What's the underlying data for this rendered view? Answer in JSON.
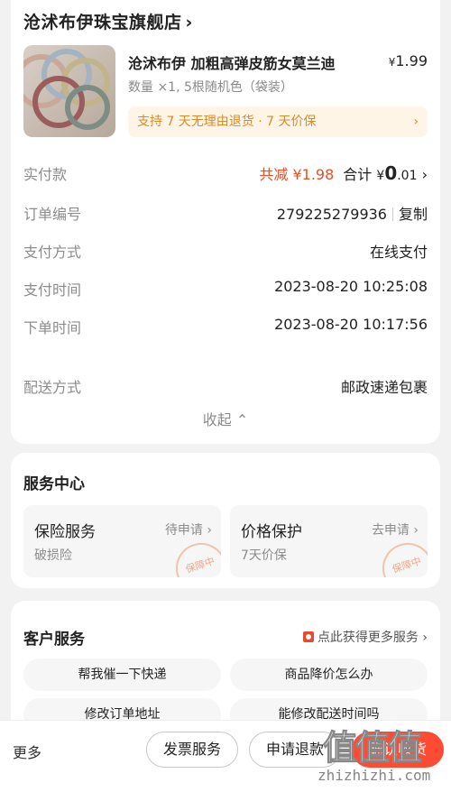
{
  "store": {
    "name": "沧沭布伊珠宝旗舰店",
    "chevron": "›"
  },
  "product": {
    "title": "沧沭布伊 加粗高弹皮筋女莫兰迪",
    "price_symbol": "¥",
    "price": "1.99",
    "spec": "数量 ×1, 5根随机色（袋装）",
    "promo": "支持 7 天无理由退货 · 7 天价保",
    "promo_chevron": "›",
    "image_icon": "hair-ties-photo"
  },
  "payment": {
    "paid_label": "实付款",
    "saved_text": "共减 ¥1.98",
    "total_label": "合计",
    "total_symbol": "¥",
    "total_int": "0",
    "total_dec": ".01",
    "chevron": "›"
  },
  "order_info": [
    {
      "label": "订单编号",
      "value": "279225279936",
      "action": "复制"
    },
    {
      "label": "支付方式",
      "value": "在线支付"
    },
    {
      "label": "支付时间",
      "value": "2023-08-20 10:25:08"
    },
    {
      "label": "下单时间",
      "value": "2023-08-20 10:17:56"
    },
    {
      "label": "配送方式",
      "value": "邮政速递包裹"
    }
  ],
  "collapse_label": "收起 ⌃",
  "service_center": {
    "title": "服务中心",
    "items": [
      {
        "title": "保险服务",
        "sub": "破损险",
        "action": "待申请 ›",
        "stamp": "保障中"
      },
      {
        "title": "价格保护",
        "sub": "7天价保",
        "action": "去申请 ›",
        "stamp": "保障中"
      }
    ]
  },
  "customer_service": {
    "title": "客户服务",
    "more": "点此获得更多服务 ›",
    "items": [
      "帮我催一下快递",
      "商品降价怎么办",
      "修改订单地址",
      "能修改配送时间吗"
    ]
  },
  "bottom_bar": {
    "more": "更多",
    "buttons": [
      "发票服务",
      "申请退款",
      "确认收货"
    ]
  },
  "watermark": {
    "logo": "值值值",
    "url": "zhizhizhi.com"
  },
  "colors": {
    "accent": "#ff4b33",
    "saved": "#e0522a",
    "promo": "#d98a2b"
  }
}
